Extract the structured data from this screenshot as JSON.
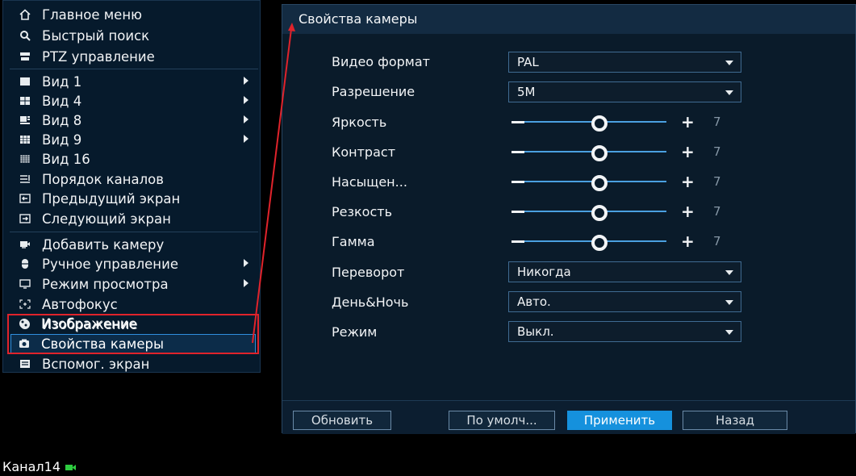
{
  "menu": {
    "items": [
      {
        "label": "Главное меню",
        "icon": "home-icon"
      },
      {
        "label": "Быстрый поиск",
        "icon": "search-icon"
      },
      {
        "label": "PTZ управление",
        "icon": "ptz-camera-icon"
      },
      {
        "label": "Вид 1",
        "icon": "view-1-icon",
        "submenu": true
      },
      {
        "label": "Вид 4",
        "icon": "view-4-icon",
        "submenu": true
      },
      {
        "label": "Вид 8",
        "icon": "view-8-icon",
        "submenu": true
      },
      {
        "label": "Вид 9",
        "icon": "view-9-icon",
        "submenu": true
      },
      {
        "label": "Вид 16",
        "icon": "view-16-icon"
      },
      {
        "label": "Порядок каналов",
        "icon": "channel-order-icon"
      },
      {
        "label": "Предыдущий экран",
        "icon": "previous-screen-icon"
      },
      {
        "label": "Следующий экран",
        "icon": "next-screen-icon"
      },
      {
        "label": "Добавить камеру",
        "icon": "add-camera-icon"
      },
      {
        "label": "Ручное управление",
        "icon": "manual-control-icon",
        "submenu": true
      },
      {
        "label": "Режим просмотра",
        "icon": "view-mode-icon",
        "submenu": true
      },
      {
        "label": "Автофокус",
        "icon": "autofocus-icon"
      },
      {
        "label": "Изображение",
        "icon": "image-icon"
      },
      {
        "label": "Свойства камеры",
        "icon": "camera-icon",
        "selected": true
      },
      {
        "label": "Вспомог. экран",
        "icon": "aux-screen-icon"
      }
    ]
  },
  "dialog": {
    "title": "Свойства камеры",
    "video_format": {
      "label": "Видео формат",
      "value": "PAL"
    },
    "resolution": {
      "label": "Разрешение",
      "value": "5M"
    },
    "brightness": {
      "label": "Яркость",
      "value": "7"
    },
    "contrast": {
      "label": "Контраст",
      "value": "7"
    },
    "saturation": {
      "label": "Насыщен...",
      "value": "7"
    },
    "sharpness": {
      "label": "Резкость",
      "value": "7"
    },
    "gamma": {
      "label": "Гамма",
      "value": "7"
    },
    "flip": {
      "label": "Переворот",
      "value": "Никогда"
    },
    "day_night": {
      "label": "День&Ночь",
      "value": "Авто."
    },
    "mode": {
      "label": "Режим",
      "value": "Выкл."
    },
    "buttons": {
      "refresh": "Обновить",
      "default": "По умолч...",
      "apply": "Применить",
      "back": "Назад"
    }
  },
  "channel": {
    "label": "Канал14"
  },
  "colors": {
    "highlight_border": "#e0232b",
    "accent": "#1591dd",
    "menu_bg": "#061a2c",
    "dialog_bg": "#0a1b2a"
  }
}
